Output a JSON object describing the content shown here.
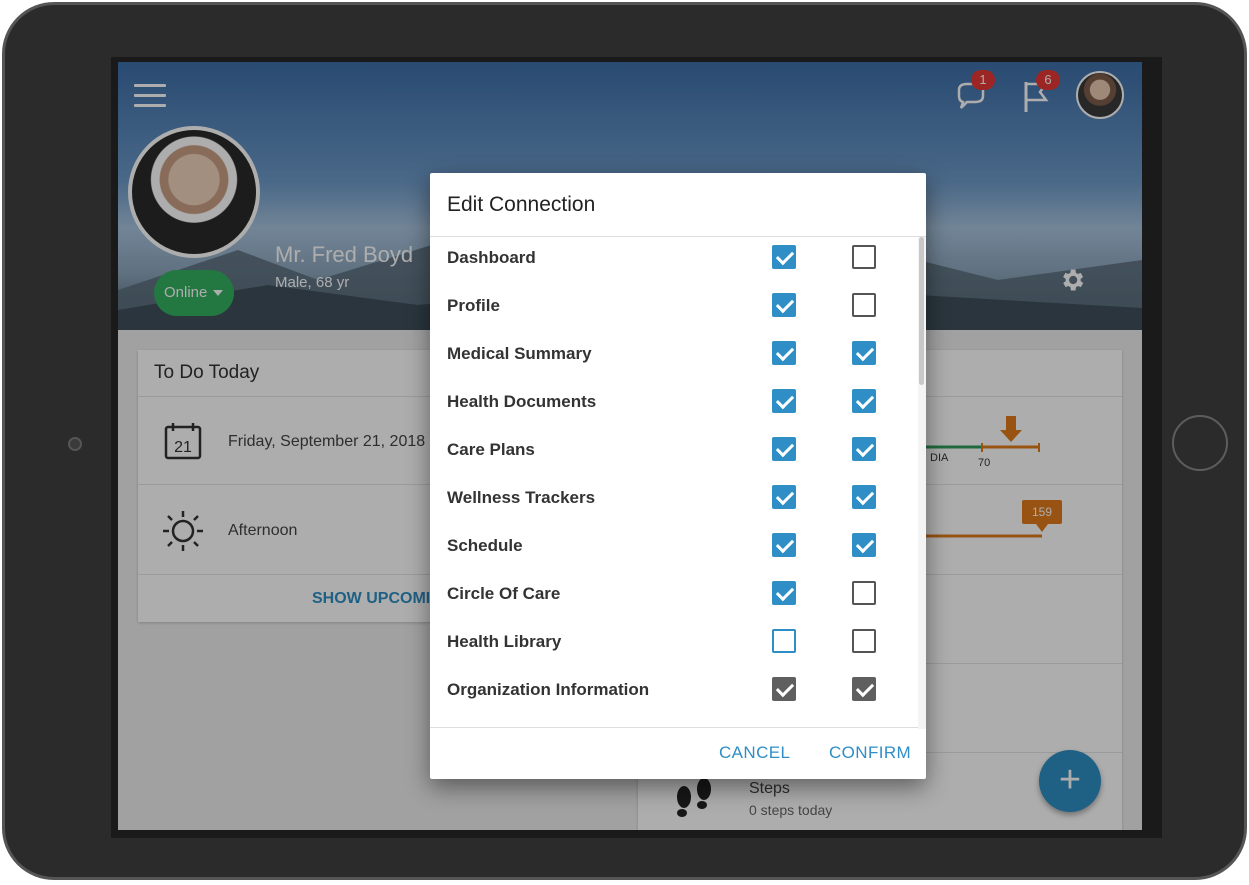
{
  "header": {
    "patient_name": "Mr. Fred Boyd",
    "patient_info": "Male, 68 yr",
    "status_label": "Online",
    "messages_badge": "1",
    "flags_badge": "6"
  },
  "todo": {
    "title": "To Do Today",
    "calendar_day": "21",
    "date_text": "Friday, September 21, 2018",
    "period_text": "Afternoon",
    "show_upcoming": "SHOW UPCOMIN"
  },
  "right_card": {
    "bp_label": "DIA",
    "bp_tick": "70",
    "marker_value": "159",
    "steps_title": "Steps",
    "steps_sub": "0 steps today"
  },
  "fab": {
    "label": "+"
  },
  "dialog": {
    "title": "Edit Connection",
    "rows": [
      {
        "label": "Dashboard",
        "col1": "checked",
        "col2": "unchecked"
      },
      {
        "label": "Profile",
        "col1": "checked",
        "col2": "unchecked"
      },
      {
        "label": "Medical Summary",
        "col1": "checked",
        "col2": "checked"
      },
      {
        "label": "Health Documents",
        "col1": "checked",
        "col2": "checked"
      },
      {
        "label": "Care Plans",
        "col1": "checked",
        "col2": "checked"
      },
      {
        "label": "Wellness Trackers",
        "col1": "checked",
        "col2": "checked"
      },
      {
        "label": "Schedule",
        "col1": "checked",
        "col2": "checked"
      },
      {
        "label": "Circle Of Care",
        "col1": "checked",
        "col2": "unchecked"
      },
      {
        "label": "Health Library",
        "col1": "unchecked",
        "col2": "unchecked"
      },
      {
        "label": "Organization Information",
        "col1": "disabled-checked",
        "col2": "disabled-checked"
      }
    ],
    "cancel_label": "CANCEL",
    "confirm_label": "CONFIRM"
  },
  "colors": {
    "accent": "#2f8ec5",
    "online": "#34b05f",
    "badge": "#e53935",
    "chart_orange": "#e07b1b",
    "chart_green": "#2e9c5a"
  }
}
